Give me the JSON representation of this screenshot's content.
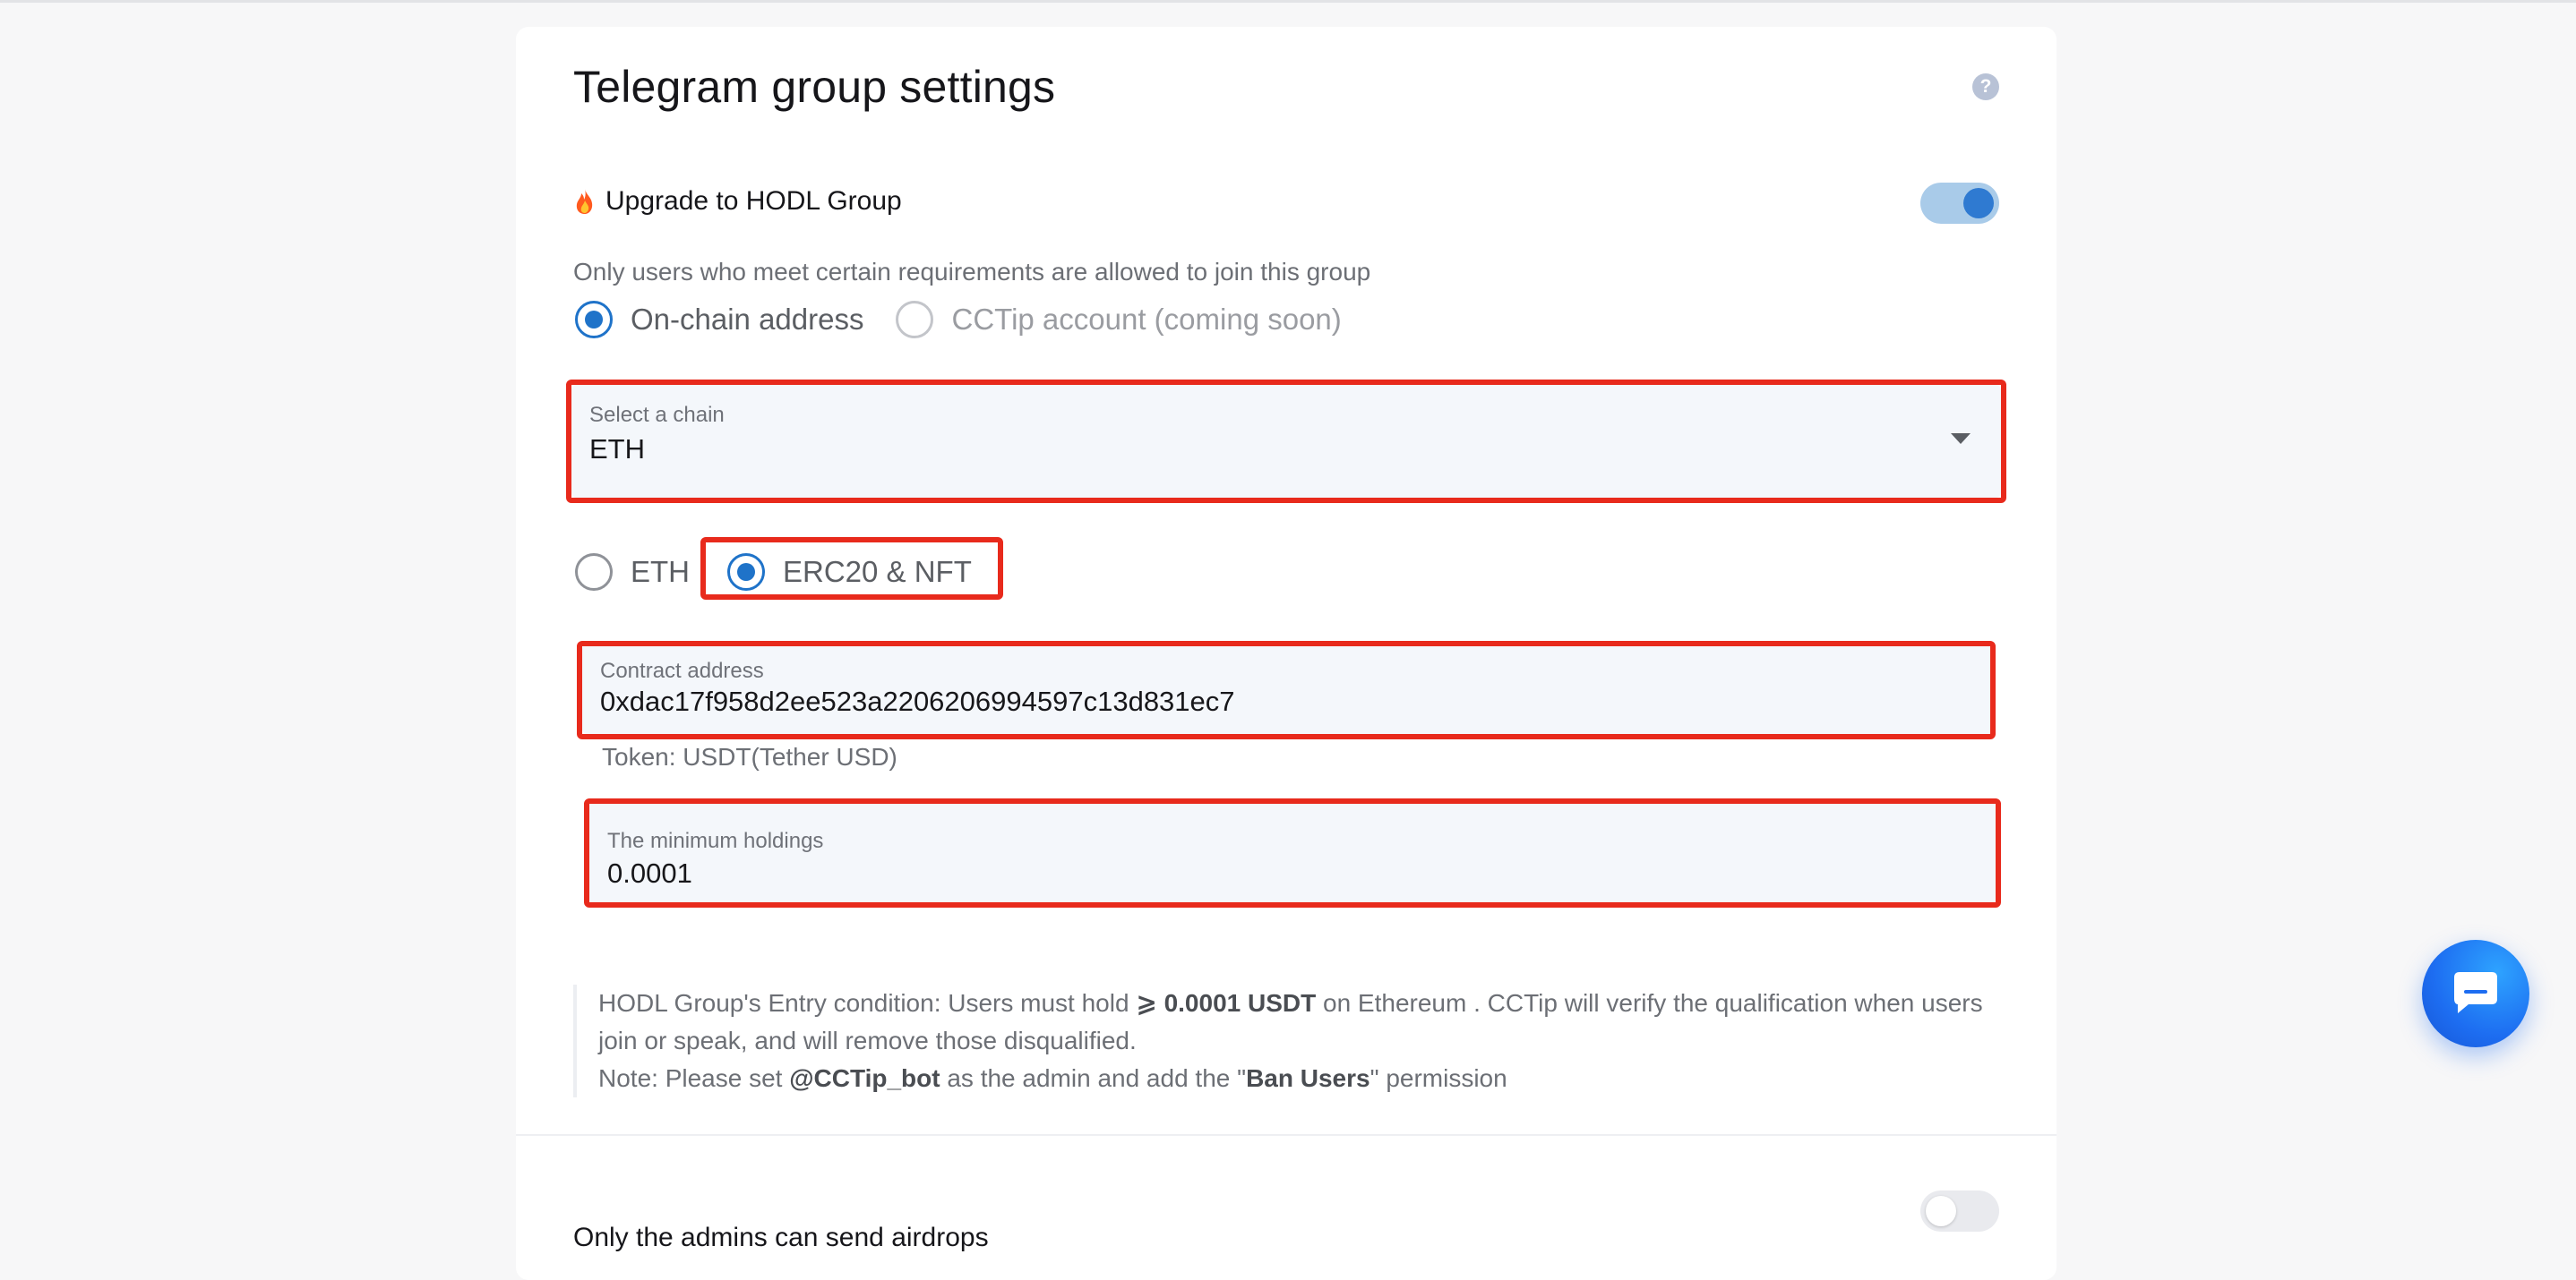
{
  "page": {
    "title": "Telegram group settings",
    "help_icon": "?"
  },
  "hodl": {
    "upgrade_label": "Upgrade to HODL Group",
    "enabled": true,
    "description": "Only users who meet certain requirements are allowed to join this group",
    "account_types": {
      "onchain_label": "On-chain address",
      "cctip_label": "CCTip account (coming soon)",
      "selected": "On-chain address"
    },
    "chain_select": {
      "label": "Select a chain",
      "value": "ETH"
    },
    "token_types": {
      "eth_label": "ETH",
      "erc20_label": "ERC20 & NFT",
      "selected": "ERC20 & NFT"
    },
    "contract": {
      "label": "Contract address",
      "value": "0xdac17f958d2ee523a2206206994597c13d831ec7",
      "token_info": "Token: USDT(Tether USD)"
    },
    "min_holdings": {
      "label": "The minimum holdings",
      "value": "0.0001"
    },
    "note": {
      "prefix": "HODL Group's Entry condition: Users must hold ",
      "amount": "⩾ 0.0001 USDT",
      "middle": " on Ethereum . CCTip will verify the qualification when users join or speak, and will remove those disqualified.",
      "note_prefix": "Note: Please set ",
      "bot": "@CCTip_bot",
      "note_middle": " as the admin and add the \"",
      "permission": "Ban Users",
      "note_suffix": "\" permission"
    }
  },
  "airdrops": {
    "label": "Only the admins can send airdrops",
    "enabled": false
  },
  "icons": {
    "upgrade": "fire-icon",
    "help": "help-icon",
    "select": "chevron-down-icon",
    "chat": "chat-bubble-icon"
  },
  "colors": {
    "accent": "#1f73c9",
    "highlight": "#e82a1c",
    "field_bg": "#f4f7fb",
    "fab": "#1d6df1"
  }
}
